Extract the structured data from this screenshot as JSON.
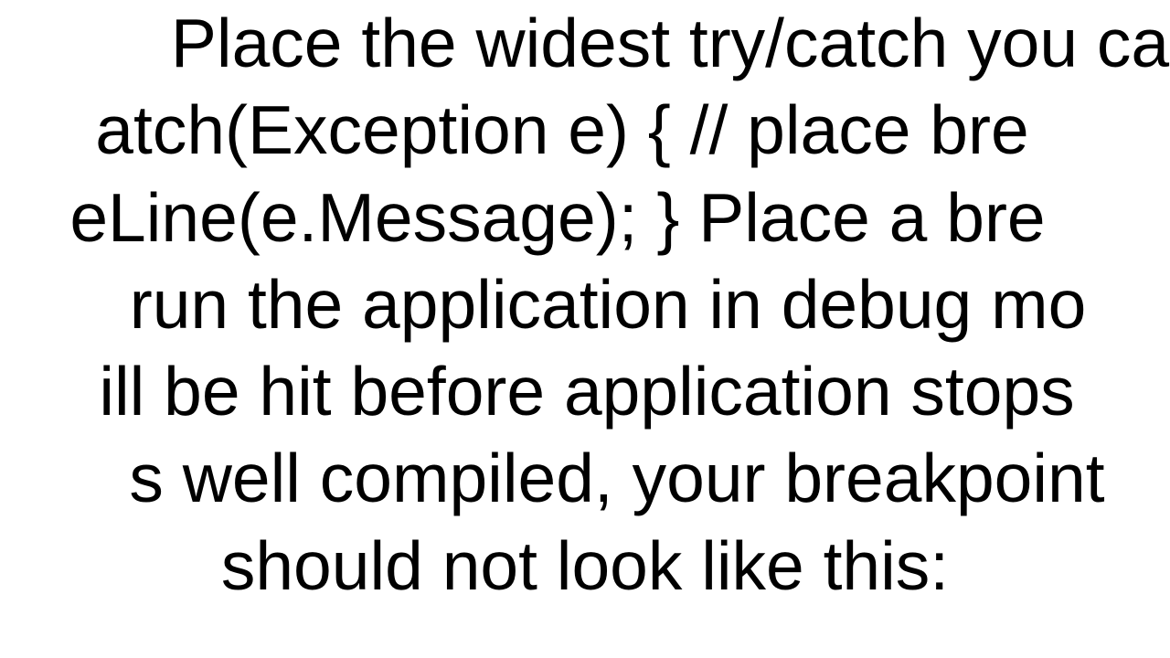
{
  "lines": {
    "l1": "Place the widest try/catch you ca",
    "l2": "atch(Exception e) {   // place bre",
    "l3": "eLine(e.Message); }  Place a bre",
    "l4": "run the application in debug mo",
    "l5": "ill be hit before application stops",
    "l6": "s well compiled, your breakpoint",
    "l7": "should not look like this:"
  }
}
